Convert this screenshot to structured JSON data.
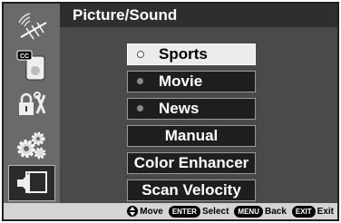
{
  "header": {
    "title": "Picture/Sound"
  },
  "sidebar": {
    "icons": [
      {
        "name": "antenna-icon"
      },
      {
        "name": "cc-icon",
        "label": "CC"
      },
      {
        "name": "lock-tools-icon"
      },
      {
        "name": "gears-icon"
      },
      {
        "name": "picture-sound-icon",
        "active": true
      }
    ]
  },
  "menu": {
    "items": [
      {
        "label": "Sports",
        "type": "radio",
        "selected": true
      },
      {
        "label": "Movie",
        "type": "radio",
        "selected": false
      },
      {
        "label": "News",
        "type": "radio",
        "selected": false
      },
      {
        "label": "Manual",
        "type": "button"
      },
      {
        "label": "Color Enhancer",
        "type": "button"
      },
      {
        "label": "Scan Velocity",
        "type": "button"
      }
    ]
  },
  "footer": {
    "move_label": "Move",
    "enter_key": "ENTER",
    "select_label": "Select",
    "menu_key": "MENU",
    "back_label": "Back",
    "exit_key": "EXIT",
    "exit_label": "Exit"
  },
  "colors": {
    "background": "#4a4a4a",
    "sidebar": "#6a6a6a",
    "title_bar": "#2e2e2e",
    "footer": "#d4d4d4",
    "selected": "#ececec"
  }
}
